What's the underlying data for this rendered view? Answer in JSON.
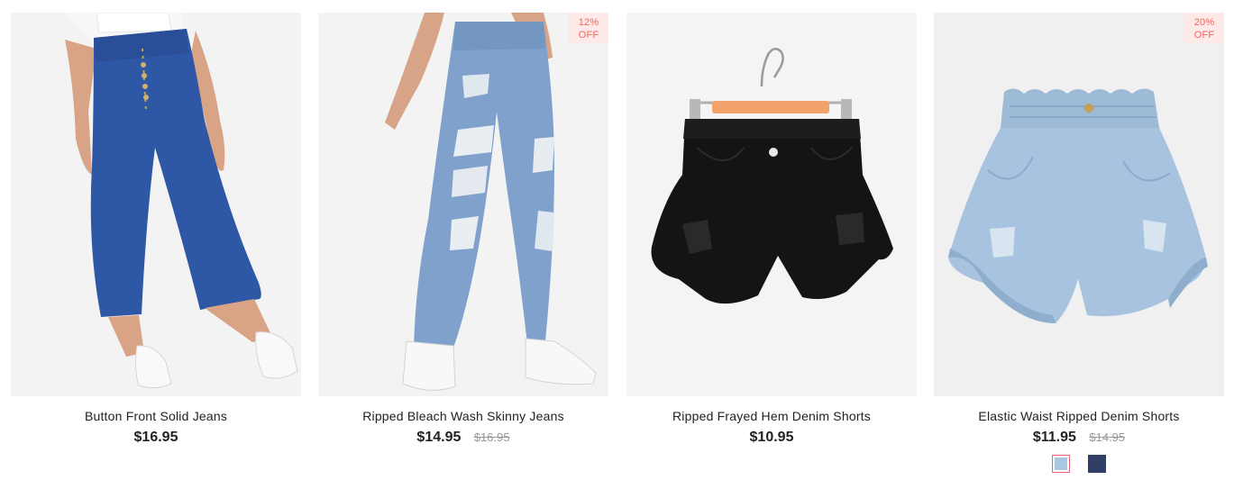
{
  "products": [
    {
      "title": "Button Front Solid Jeans",
      "price": "$16.95",
      "old_price": "",
      "discount": null,
      "image": "cropped-flare-jeans-photo"
    },
    {
      "title": "Ripped Bleach Wash Skinny Jeans",
      "price": "$14.95",
      "old_price": "$16.95",
      "discount": {
        "percent": "12%",
        "label": "OFF"
      },
      "image": "ripped-skinny-jeans-photo"
    },
    {
      "title": "Ripped Frayed Hem Denim Shorts",
      "price": "$10.95",
      "old_price": "",
      "discount": null,
      "image": "black-denim-shorts-on-hanger-photo"
    },
    {
      "title": "Elastic Waist Ripped Denim Shorts",
      "price": "$11.95",
      "old_price": "$14.95",
      "discount": {
        "percent": "20%",
        "label": "OFF"
      },
      "image": "light-paperbag-denim-shorts-photo",
      "swatches": [
        {
          "color": "#a9c6e2",
          "selected": true
        },
        {
          "color": "#2f3f66",
          "selected": false
        }
      ]
    }
  ],
  "colors": {
    "badge_bg": "#fde9e8",
    "badge_text": "#f4655c",
    "price_text": "#222222",
    "old_price_text": "#999999",
    "swatch_selected_border": "#e9627b"
  }
}
